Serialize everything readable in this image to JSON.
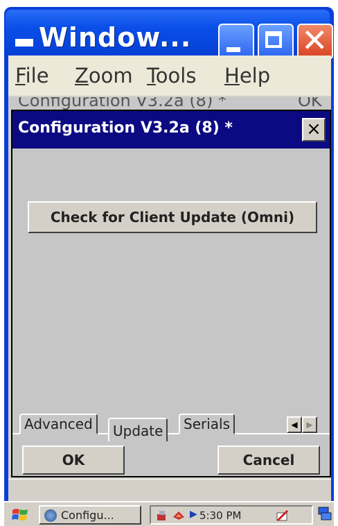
{
  "window": {
    "title": "Window..."
  },
  "menubar": {
    "items": [
      "File",
      "Zoom",
      "Tools",
      "Help"
    ]
  },
  "background_dialog": {
    "title": "Configuration V3.2a (8) *",
    "button": "OK"
  },
  "dialog": {
    "title": "Configuration V3.2a (8)  *",
    "close_label": "×",
    "check_button": "Check for Client Update (Omni)",
    "tabs": [
      "Advanced",
      "Update",
      "Serials"
    ],
    "active_tab": "Update",
    "ok_label": "OK",
    "cancel_label": "Cancel"
  },
  "taskbar": {
    "task_label": "Configu...",
    "clock": "5:30 PM"
  },
  "icons": {
    "start": "windows-flag-icon",
    "task": "config-globe-icon",
    "tray": [
      "network-icon",
      "speaker-icon",
      "arrow-icon",
      "pen-input-icon",
      "desktop-icon"
    ]
  },
  "colors": {
    "xp_title": "#0a4fe8",
    "dialog_title": "#0c0a82",
    "close_red": "#d94020",
    "face": "#d4d0c8"
  }
}
